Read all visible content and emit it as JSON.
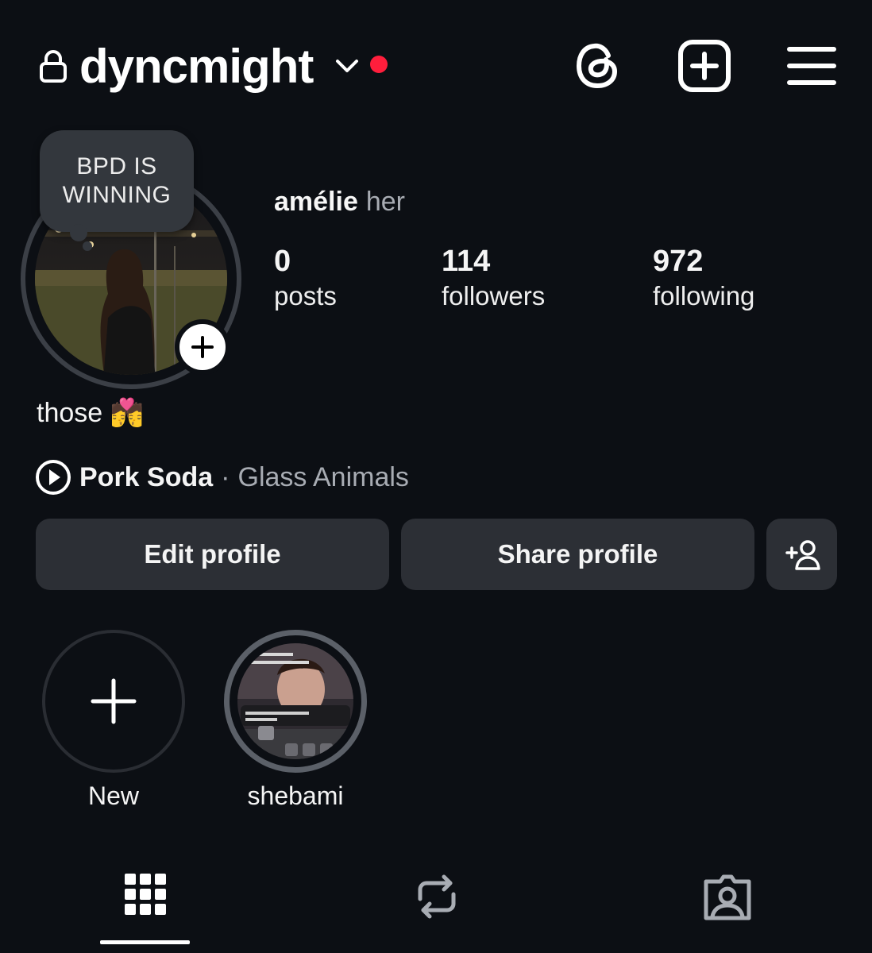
{
  "header": {
    "username": "dyncmight",
    "notification_dot_color": "#ff1e3c",
    "icons": [
      "lock-icon",
      "chevron-down-icon",
      "threads-icon",
      "create-icon",
      "menu-icon"
    ]
  },
  "profile": {
    "note": "BPD IS WINNING",
    "name": "amélie",
    "pronouns": "her",
    "stats": {
      "posts": {
        "value": "0",
        "label": "posts"
      },
      "followers": {
        "value": "114",
        "label": "followers"
      },
      "following": {
        "value": "972",
        "label": "following"
      }
    },
    "bio": "those 💏",
    "music": {
      "song": "Pork Soda",
      "separator": "·",
      "artist": "Glass Animals"
    }
  },
  "actions": {
    "edit": "Edit profile",
    "share": "Share profile",
    "discover_icon": "add-person-icon"
  },
  "highlights": [
    {
      "label": "New"
    },
    {
      "label": "shebami"
    }
  ],
  "tabs": [
    "grid-icon",
    "reposts-icon",
    "tagged-icon"
  ]
}
